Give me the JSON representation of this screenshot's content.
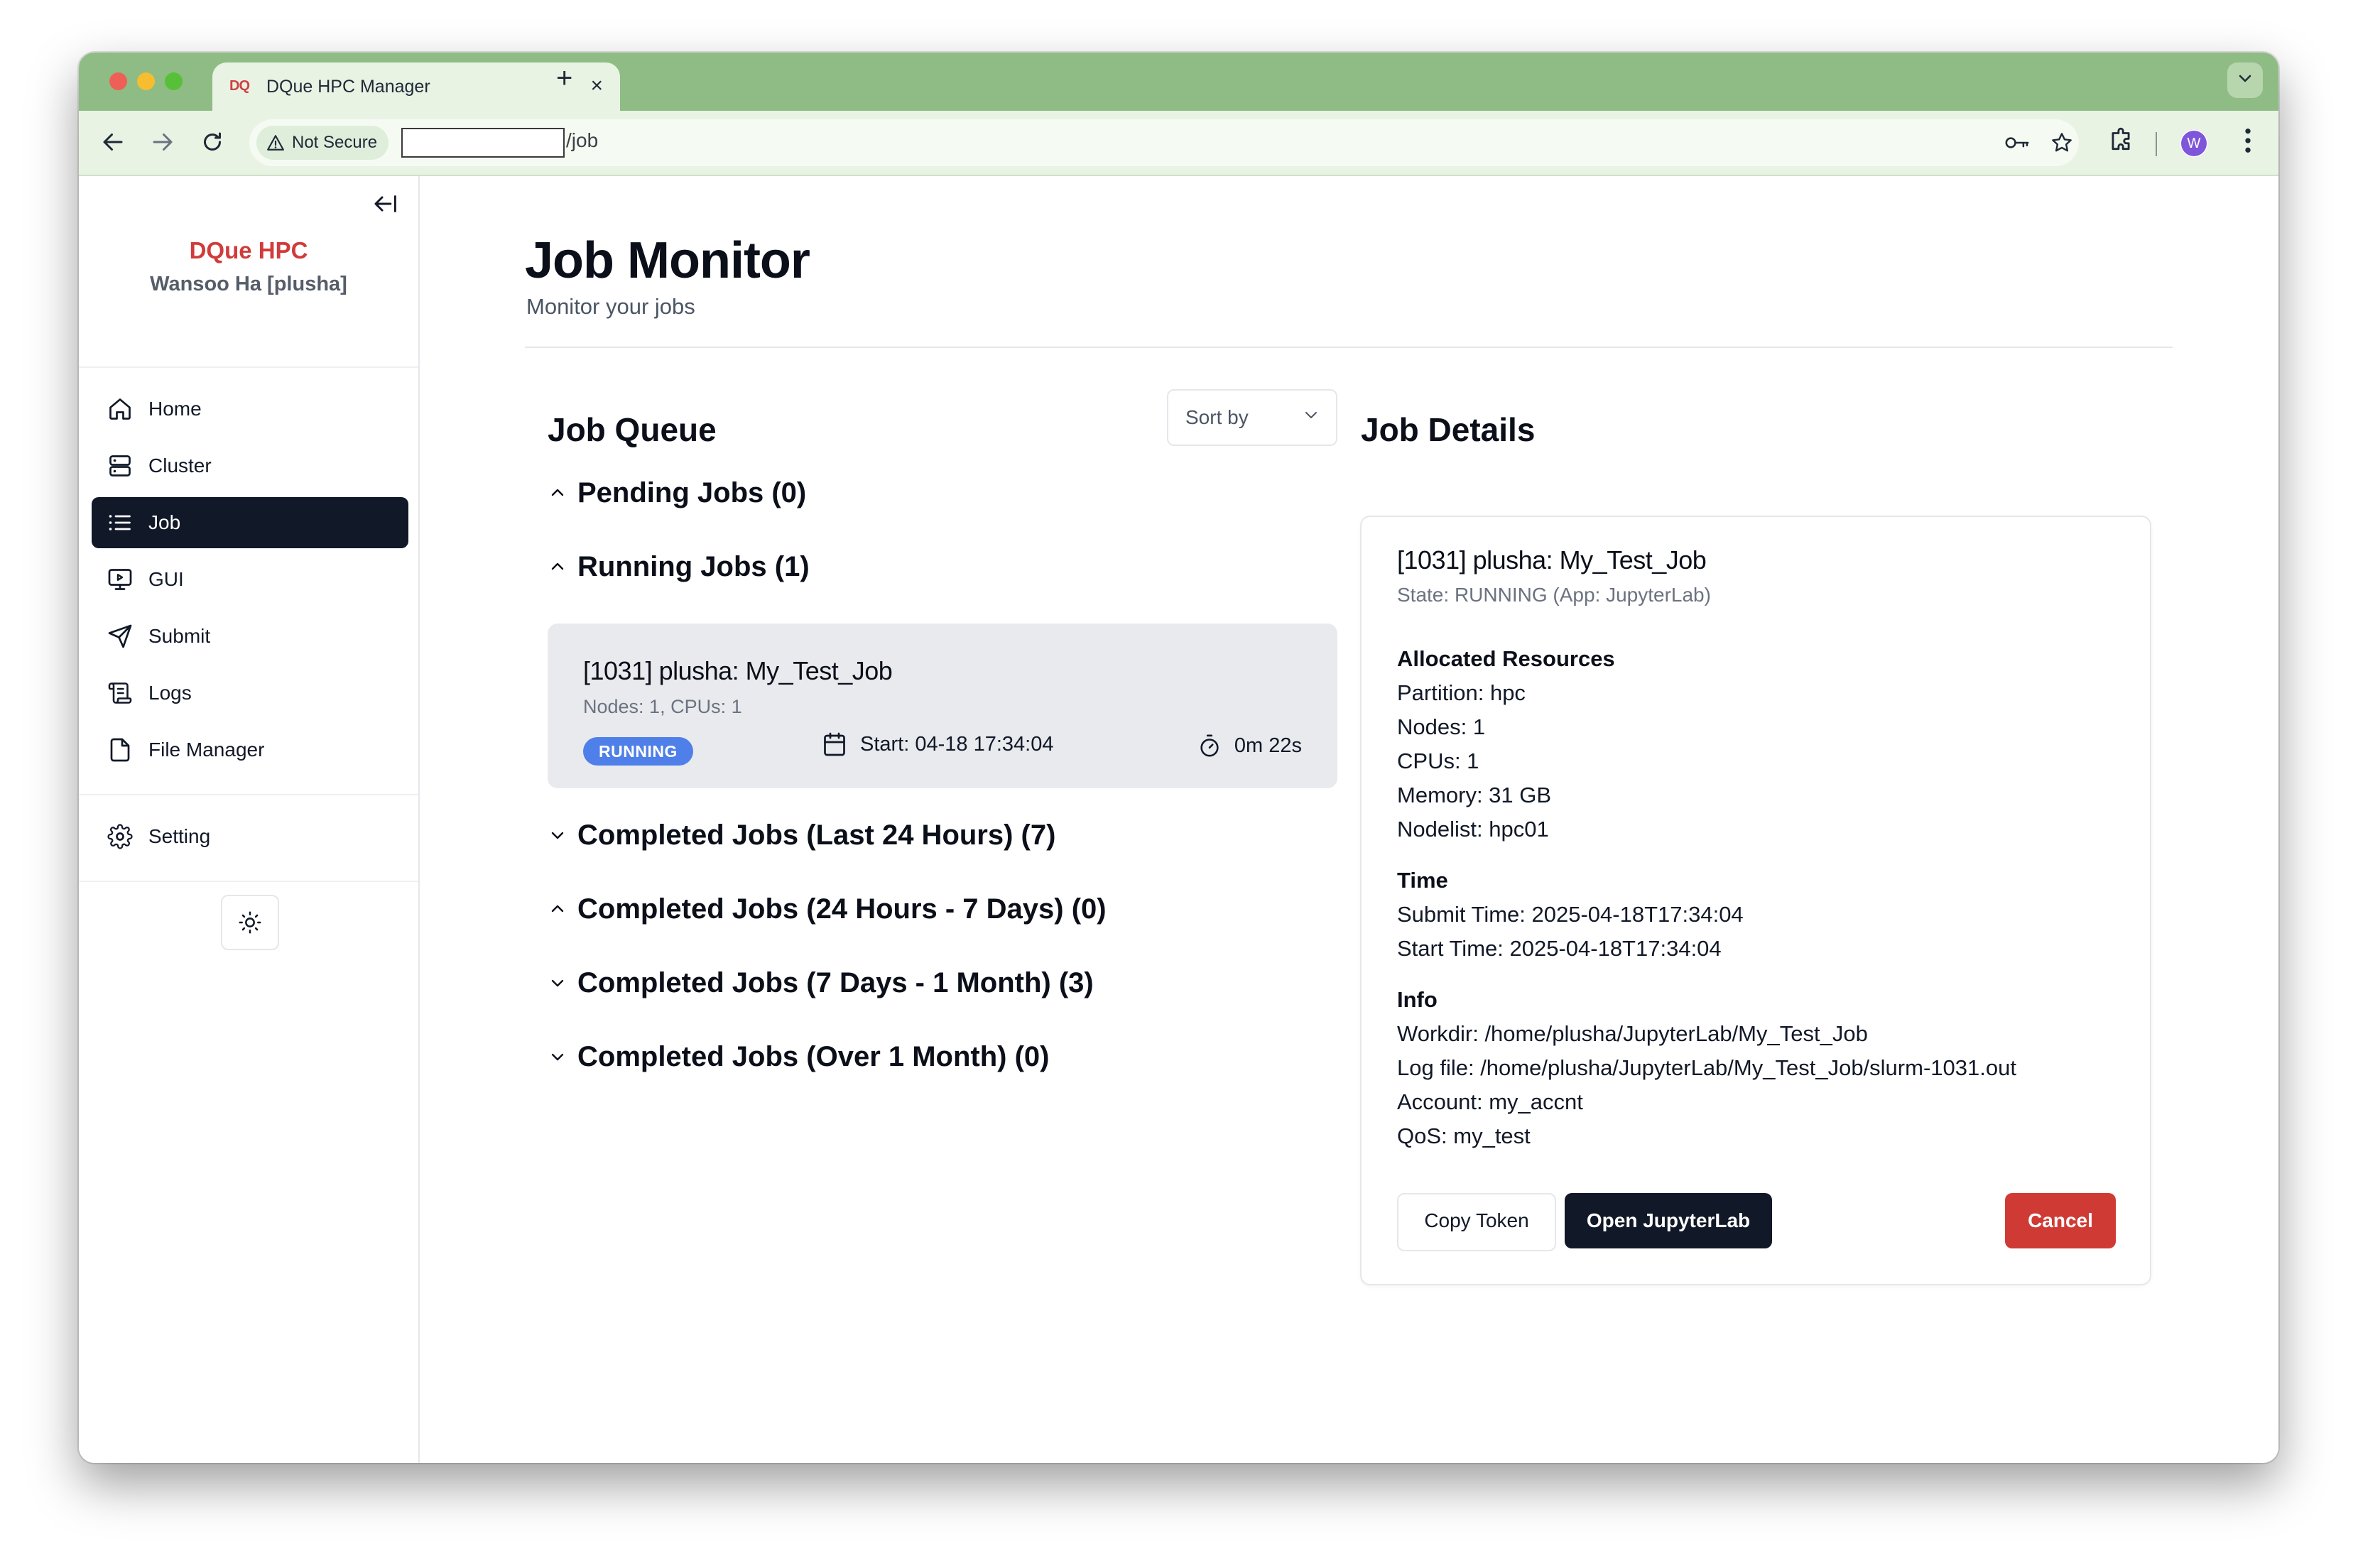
{
  "browser": {
    "tab_title": "DQue HPC Manager",
    "tab_favicon": "DQ",
    "security_label": "Not Secure",
    "url_path": "/job",
    "avatar_letter": "W",
    "theme_color": "#8fbc84"
  },
  "sidebar": {
    "brand": "DQue HPC",
    "user": "Wansoo Ha [plusha]",
    "items": [
      {
        "label": "Home",
        "icon": "home-icon"
      },
      {
        "label": "Cluster",
        "icon": "server-icon"
      },
      {
        "label": "Job",
        "icon": "list-icon",
        "active": true
      },
      {
        "label": "GUI",
        "icon": "monitor-icon"
      },
      {
        "label": "Submit",
        "icon": "send-icon"
      },
      {
        "label": "Logs",
        "icon": "scroll-icon"
      },
      {
        "label": "File Manager",
        "icon": "file-icon"
      }
    ],
    "setting": {
      "label": "Setting",
      "icon": "gear-icon"
    },
    "theme_icon": "sun-icon"
  },
  "header": {
    "title": "Job Monitor",
    "subtitle": "Monitor your jobs"
  },
  "queue": {
    "title": "Job Queue",
    "sort_label": "Sort by",
    "sections": [
      {
        "label": "Pending Jobs (0)",
        "expanded": true
      },
      {
        "label": "Running Jobs (1)",
        "expanded": true
      },
      {
        "label": "Completed Jobs (Last 24 Hours) (7)",
        "expanded": false
      },
      {
        "label": "Completed Jobs (24 Hours - 7 Days) (0)",
        "expanded": true
      },
      {
        "label": "Completed Jobs (7 Days - 1 Month) (3)",
        "expanded": false
      },
      {
        "label": "Completed Jobs (Over 1 Month) (0)",
        "expanded": false
      }
    ],
    "running_job": {
      "title": "[1031] plusha: My_Test_Job",
      "subtitle": "Nodes: 1, CPUs: 1",
      "status": "RUNNING",
      "start": "Start: 04-18 17:34:04",
      "elapsed": "0m 22s"
    }
  },
  "details": {
    "title": "Job Details",
    "job_title": "[1031] plusha: My_Test_Job",
    "state": "State: RUNNING (App: JupyterLab)",
    "resources_heading": "Allocated Resources",
    "partition": "Partition: hpc",
    "nodes": "Nodes: 1",
    "cpus": "CPUs: 1",
    "memory": "Memory: 31 GB",
    "nodelist": "Nodelist: hpc01",
    "time_heading": "Time",
    "submit_time": "Submit Time: 2025-04-18T17:34:04",
    "start_time": "Start Time: 2025-04-18T17:34:04",
    "info_heading": "Info",
    "workdir": "Workdir: /home/plusha/JupyterLab/My_Test_Job",
    "logfile": "Log file: /home/plusha/JupyterLab/My_Test_Job/slurm-1031.out",
    "account": "Account: my_accnt",
    "qos": "QoS: my_test",
    "copy_token": "Copy Token",
    "open_app": "Open JupyterLab",
    "cancel": "Cancel"
  }
}
